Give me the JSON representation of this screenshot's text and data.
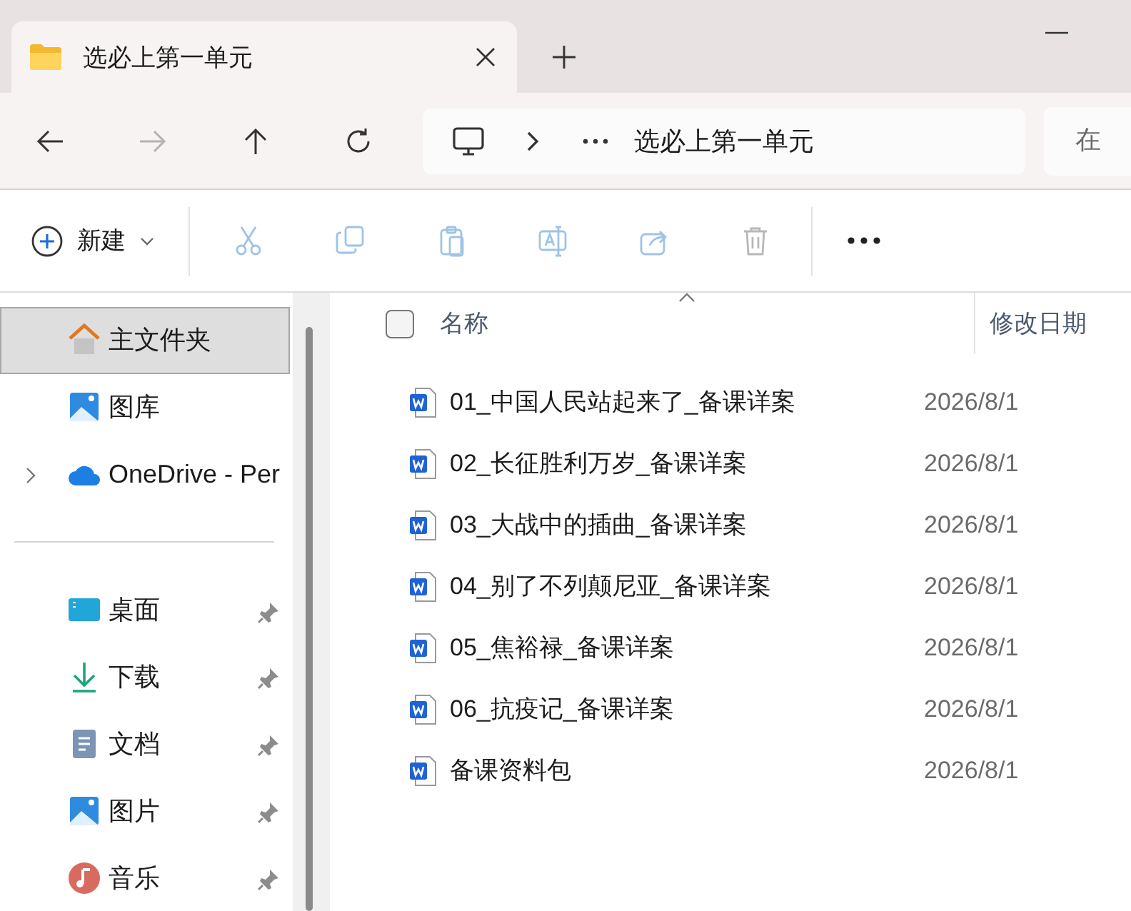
{
  "tab": {
    "title": "选必上第一单元",
    "selected": true
  },
  "address": {
    "path": "选必上第一单元"
  },
  "search": {
    "placeholder": "在"
  },
  "nav": [
    {
      "kind": "back",
      "disabled": false
    },
    {
      "kind": "forward",
      "disabled": true
    },
    {
      "kind": "up",
      "disabled": false
    },
    {
      "kind": "refresh",
      "disabled": false
    }
  ],
  "toolbar": {
    "new_label": "新建",
    "actions": [
      {
        "kind": "cut",
        "disabled": true
      },
      {
        "kind": "copy",
        "disabled": true
      },
      {
        "kind": "paste",
        "disabled": true
      },
      {
        "kind": "rename",
        "disabled": true
      },
      {
        "kind": "share",
        "disabled": true
      },
      {
        "kind": "delete",
        "disabled": true
      }
    ]
  },
  "sidebar": {
    "top_items": [
      {
        "label": "主文件夹",
        "kind": "home",
        "selected": true
      },
      {
        "label": "图库",
        "kind": "gallery",
        "selected": false
      },
      {
        "label": "OneDrive - Per",
        "kind": "cloud",
        "selected": false,
        "expanded": false
      }
    ],
    "quick_access": [
      {
        "label": "桌面",
        "kind": "desktop",
        "selected": false,
        "pinned": true
      },
      {
        "label": "下载",
        "kind": "download",
        "selected": false,
        "pinned": true
      },
      {
        "label": "文档",
        "kind": "documents",
        "selected": false,
        "pinned": true
      },
      {
        "label": "图片",
        "kind": "pictures",
        "selected": false,
        "pinned": true
      },
      {
        "label": "音乐",
        "kind": "music",
        "selected": false,
        "pinned": true
      }
    ]
  },
  "file_list": {
    "select_all_checked": false,
    "columns": [
      {
        "label": "名称",
        "sorted": true
      },
      {
        "label": "修改日期",
        "sorted": false
      }
    ],
    "rows": [
      {
        "name": "01_中国人民站起来了_备课详案",
        "date": "2026/8/1"
      },
      {
        "name": "02_长征胜利万岁_备课详案",
        "date": "2026/8/1"
      },
      {
        "name": "03_大战中的插曲_备课详案",
        "date": "2026/8/1"
      },
      {
        "name": "04_别了不列颠尼亚_备课详案",
        "date": "2026/8/1"
      },
      {
        "name": "05_焦裕禄_备课详案",
        "date": "2026/8/1"
      },
      {
        "name": "06_抗疫记_备课详案",
        "date": "2026/8/1"
      },
      {
        "name": "备课资料包",
        "date": "2026/8/1"
      }
    ]
  }
}
